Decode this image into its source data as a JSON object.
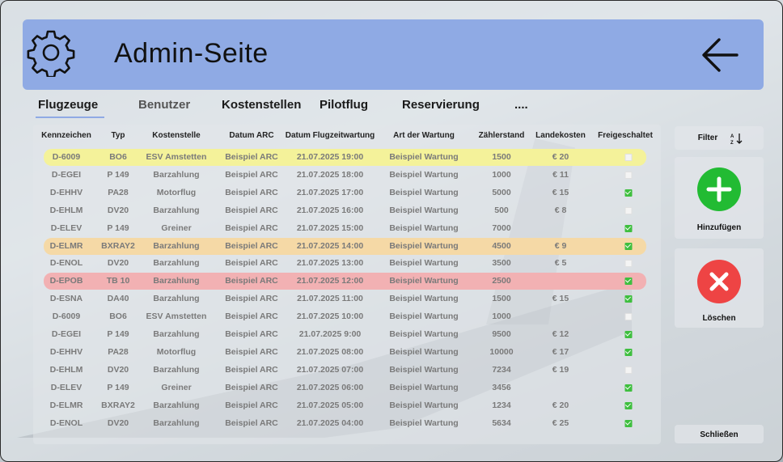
{
  "header": {
    "title": "Admin-Seite",
    "settings_icon": "gear-icon",
    "back_icon": "arrow-left-icon",
    "color": "#8faae4"
  },
  "tabs": [
    {
      "label": "Flugzeuge",
      "active": true
    },
    {
      "label": "Benutzer",
      "active": false
    },
    {
      "label": "Kostenstellen",
      "active": false
    },
    {
      "label": "Pilotflug",
      "active": false
    },
    {
      "label": "Reservierung",
      "active": false
    },
    {
      "label": "....",
      "active": false
    }
  ],
  "table": {
    "columns": [
      "Kennzeichen",
      "Typ",
      "Kostenstelle",
      "Datum ARC",
      "Datum Flugzeitwartung",
      "Art der Wartung",
      "Zählerstand",
      "Landekosten",
      "Freigeschaltet"
    ],
    "rows": [
      {
        "kennzeichen": "D-6009",
        "typ": "BO6",
        "kostenstelle": "ESV Amstetten",
        "datum_arc": "Beispiel ARC",
        "datum_wartung": "21.07.2025 19:00",
        "art": "Beispiel Wartung",
        "zaehler": "1500",
        "landekosten": "€ 20",
        "freigeschaltet": false,
        "highlight": "yellow"
      },
      {
        "kennzeichen": "D-EGEI",
        "typ": "P 149",
        "kostenstelle": "Barzahlung",
        "datum_arc": "Beispiel ARC",
        "datum_wartung": "21.07.2025 18:00",
        "art": "Beispiel Wartung",
        "zaehler": "1000",
        "landekosten": "€ 11",
        "freigeschaltet": false,
        "highlight": ""
      },
      {
        "kennzeichen": "D-EHHV",
        "typ": "PA28",
        "kostenstelle": "Motorflug",
        "datum_arc": "Beispiel ARC",
        "datum_wartung": "21.07.2025 17:00",
        "art": "Beispiel Wartung",
        "zaehler": "5000",
        "landekosten": "€ 15",
        "freigeschaltet": true,
        "highlight": ""
      },
      {
        "kennzeichen": "D-EHLM",
        "typ": "DV20",
        "kostenstelle": "Barzahlung",
        "datum_arc": "Beispiel ARC",
        "datum_wartung": "21.07.2025 16:00",
        "art": "Beispiel Wartung",
        "zaehler": "500",
        "landekosten": "€ 8",
        "freigeschaltet": false,
        "highlight": ""
      },
      {
        "kennzeichen": "D-ELEV",
        "typ": "P 149",
        "kostenstelle": "Greiner",
        "datum_arc": "Beispiel ARC",
        "datum_wartung": "21.07.2025 15:00",
        "art": "Beispiel Wartung",
        "zaehler": "7000",
        "landekosten": "",
        "freigeschaltet": true,
        "highlight": ""
      },
      {
        "kennzeichen": "D-ELMR",
        "typ": "BXRAY2",
        "kostenstelle": "Barzahlung",
        "datum_arc": "Beispiel ARC",
        "datum_wartung": "21.07.2025 14:00",
        "art": "Beispiel Wartung",
        "zaehler": "4500",
        "landekosten": "€ 9",
        "freigeschaltet": true,
        "highlight": "orange"
      },
      {
        "kennzeichen": "D-ENOL",
        "typ": "DV20",
        "kostenstelle": "Barzahlung",
        "datum_arc": "Beispiel ARC",
        "datum_wartung": "21.07.2025 13:00",
        "art": "Beispiel Wartung",
        "zaehler": "3500",
        "landekosten": "€ 5",
        "freigeschaltet": false,
        "highlight": ""
      },
      {
        "kennzeichen": "D-EPOB",
        "typ": "TB 10",
        "kostenstelle": "Barzahlung",
        "datum_arc": "Beispiel ARC",
        "datum_wartung": "21.07.2025 12:00",
        "art": "Beispiel Wartung",
        "zaehler": "2500",
        "landekosten": "",
        "freigeschaltet": true,
        "highlight": "red"
      },
      {
        "kennzeichen": "D-ESNA",
        "typ": "DA40",
        "kostenstelle": "Barzahlung",
        "datum_arc": "Beispiel ARC",
        "datum_wartung": "21.07.2025 11:00",
        "art": "Beispiel Wartung",
        "zaehler": "1500",
        "landekosten": "€ 15",
        "freigeschaltet": true,
        "highlight": ""
      },
      {
        "kennzeichen": "D-6009",
        "typ": "BO6",
        "kostenstelle": "ESV Amstetten",
        "datum_arc": "Beispiel ARC",
        "datum_wartung": "21.07.2025 10:00",
        "art": "Beispiel Wartung",
        "zaehler": "1000",
        "landekosten": "",
        "freigeschaltet": false,
        "highlight": ""
      },
      {
        "kennzeichen": "D-EGEI",
        "typ": "P 149",
        "kostenstelle": "Barzahlung",
        "datum_arc": "Beispiel ARC",
        "datum_wartung": "21.07.2025 9:00",
        "art": "Beispiel Wartung",
        "zaehler": "9500",
        "landekosten": "€ 12",
        "freigeschaltet": true,
        "highlight": ""
      },
      {
        "kennzeichen": "D-EHHV",
        "typ": "PA28",
        "kostenstelle": "Motorflug",
        "datum_arc": "Beispiel ARC",
        "datum_wartung": "21.07.2025 08:00",
        "art": "Beispiel Wartung",
        "zaehler": "10000",
        "landekosten": "€ 17",
        "freigeschaltet": true,
        "highlight": ""
      },
      {
        "kennzeichen": "D-EHLM",
        "typ": "DV20",
        "kostenstelle": "Barzahlung",
        "datum_arc": "Beispiel ARC",
        "datum_wartung": "21.07.2025 07:00",
        "art": "Beispiel Wartung",
        "zaehler": "7234",
        "landekosten": "€ 19",
        "freigeschaltet": false,
        "highlight": ""
      },
      {
        "kennzeichen": "D-ELEV",
        "typ": "P 149",
        "kostenstelle": "Greiner",
        "datum_arc": "Beispiel ARC",
        "datum_wartung": "21.07.2025 06:00",
        "art": "Beispiel Wartung",
        "zaehler": "3456",
        "landekosten": "",
        "freigeschaltet": true,
        "highlight": ""
      },
      {
        "kennzeichen": "D-ELMR",
        "typ": "BXRAY2",
        "kostenstelle": "Barzahlung",
        "datum_arc": "Beispiel ARC",
        "datum_wartung": "21.07.2025 05:00",
        "art": "Beispiel Wartung",
        "zaehler": "1234",
        "landekosten": "€ 20",
        "freigeschaltet": true,
        "highlight": ""
      },
      {
        "kennzeichen": "D-ENOL",
        "typ": "DV20",
        "kostenstelle": "Barzahlung",
        "datum_arc": "Beispiel ARC",
        "datum_wartung": "21.07.2025 04:00",
        "art": "Beispiel Wartung",
        "zaehler": "5634",
        "landekosten": "€ 25",
        "freigeschaltet": true,
        "highlight": ""
      }
    ]
  },
  "sidebar": {
    "filter_label": "Filter",
    "sort_icon": "sort-az-icon",
    "add_label": "Hinzufügen",
    "add_icon": "plus-icon",
    "delete_label": "Löschen",
    "delete_icon": "x-icon",
    "close_label": "Schließen"
  },
  "colors": {
    "highlight_yellow": "#f4f29a",
    "highlight_orange": "#f5d9a6",
    "highlight_red": "#f2b1b3",
    "add_green": "#22bb33",
    "delete_red": "#ee4444",
    "check_green": "#3fbf3f"
  }
}
